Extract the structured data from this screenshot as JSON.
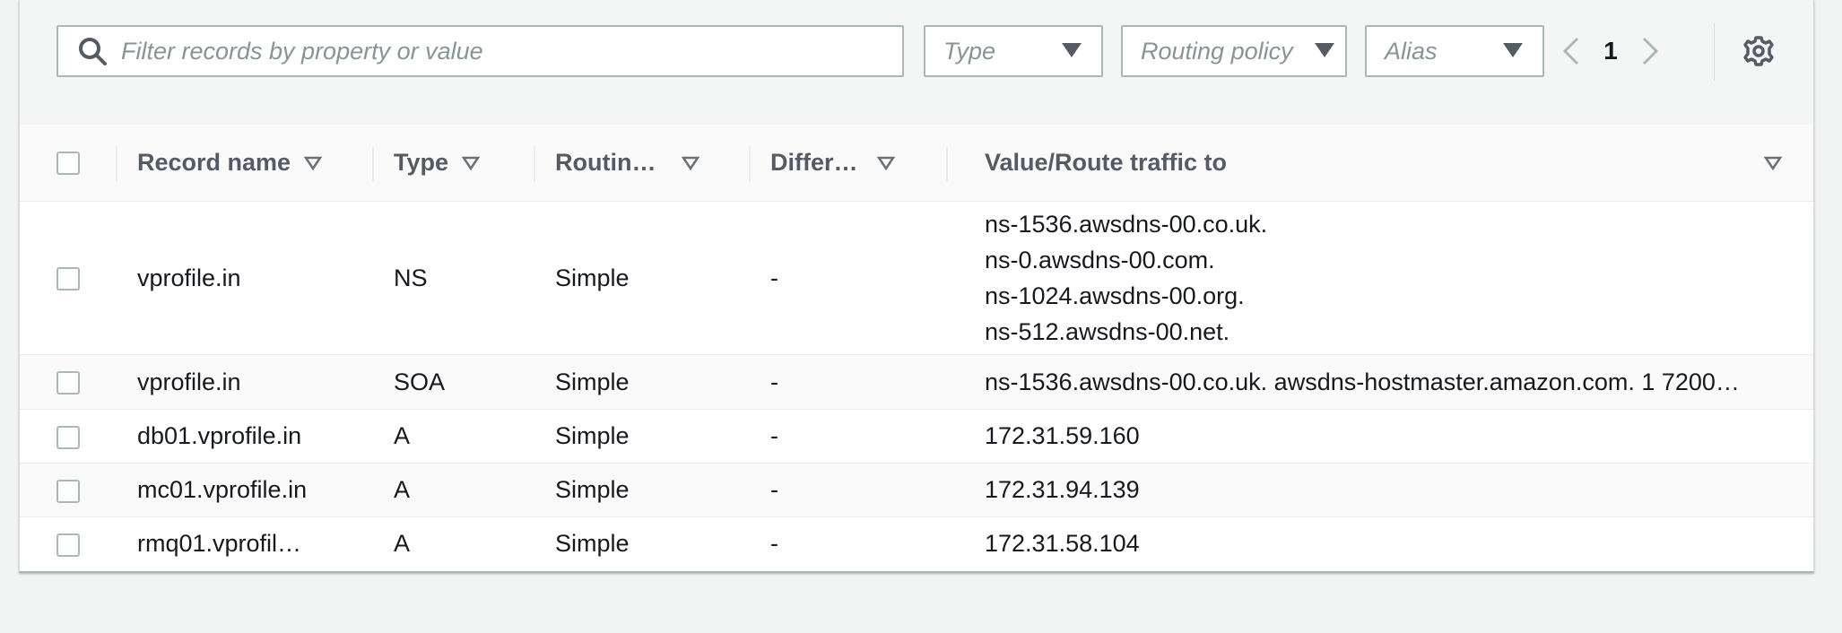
{
  "toolbar": {
    "filter_placeholder": "Filter records by property or value",
    "filters": [
      {
        "label": "Type"
      },
      {
        "label": "Routing policy"
      },
      {
        "label": "Alias"
      }
    ],
    "page": "1"
  },
  "table": {
    "columns": [
      "Record name",
      "Type",
      "Routin…",
      "Differ…",
      "Value/Route traffic to"
    ],
    "rows": [
      {
        "name": "vprofile.in",
        "type": "NS",
        "routing": "Simple",
        "differ": "-",
        "values": [
          "ns-1536.awsdns-00.co.uk.",
          "ns-0.awsdns-00.com.",
          "ns-1024.awsdns-00.org.",
          "ns-512.awsdns-00.net."
        ]
      },
      {
        "name": "vprofile.in",
        "type": "SOA",
        "routing": "Simple",
        "differ": "-",
        "values": [
          "ns-1536.awsdns-00.co.uk. awsdns-hostmaster.amazon.com. 1 7200…"
        ]
      },
      {
        "name": "db01.vprofile.in",
        "type": "A",
        "routing": "Simple",
        "differ": "-",
        "values": [
          "172.31.59.160"
        ]
      },
      {
        "name": "mc01.vprofile.in",
        "type": "A",
        "routing": "Simple",
        "differ": "-",
        "values": [
          "172.31.94.139"
        ]
      },
      {
        "name": "rmq01.vprofil…",
        "type": "A",
        "routing": "Simple",
        "differ": "-",
        "values": [
          "172.31.58.104"
        ]
      }
    ]
  }
}
